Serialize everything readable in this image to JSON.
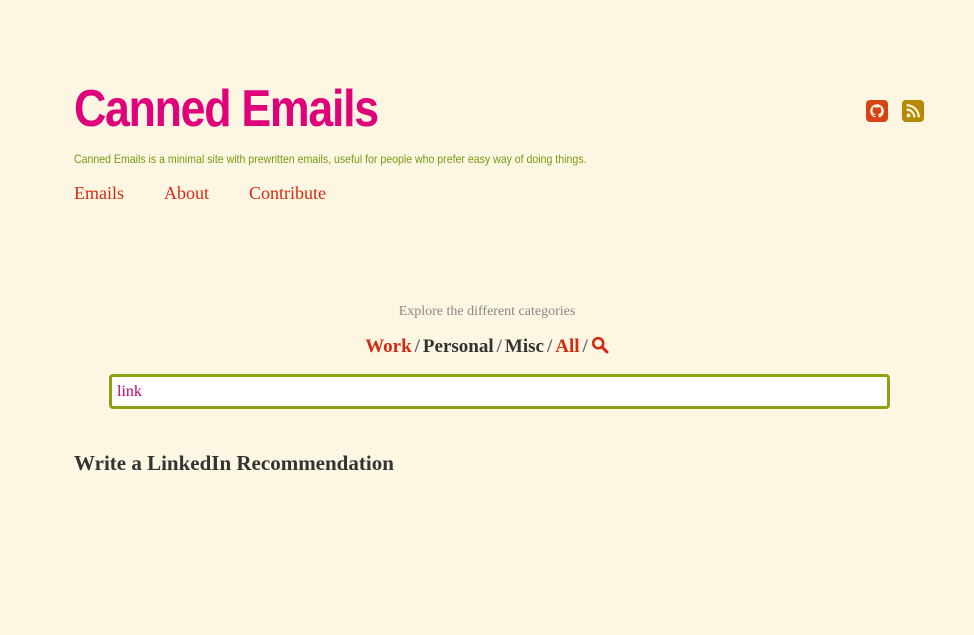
{
  "site": {
    "title": "Canned Emails",
    "tagline": "Canned Emails is a minimal site with prewritten emails, useful for people who prefer easy way of doing things."
  },
  "nav": [
    {
      "label": "Emails"
    },
    {
      "label": "About"
    },
    {
      "label": "Contribute"
    }
  ],
  "social": {
    "github_icon": "github-icon",
    "rss_icon": "rss-icon"
  },
  "categories": {
    "heading": "Explore the different categories",
    "items": [
      {
        "label": "Work",
        "active": true
      },
      {
        "label": "Personal",
        "active": false
      },
      {
        "label": "Misc",
        "active": false
      },
      {
        "label": "All",
        "active": true
      }
    ],
    "separator": "/",
    "search_icon": "search-icon"
  },
  "search": {
    "value": "link",
    "placeholder": ""
  },
  "results": [
    {
      "title": "Write a LinkedIn Recommendation"
    }
  ],
  "colors": {
    "background": "#fdf6e3",
    "title": "#e0007a",
    "tagline": "#7a9a12",
    "link": "#d42a12",
    "github": "#d84315",
    "rss": "#b58900",
    "search_border": "#8aa114",
    "search_text": "#c0006a"
  }
}
